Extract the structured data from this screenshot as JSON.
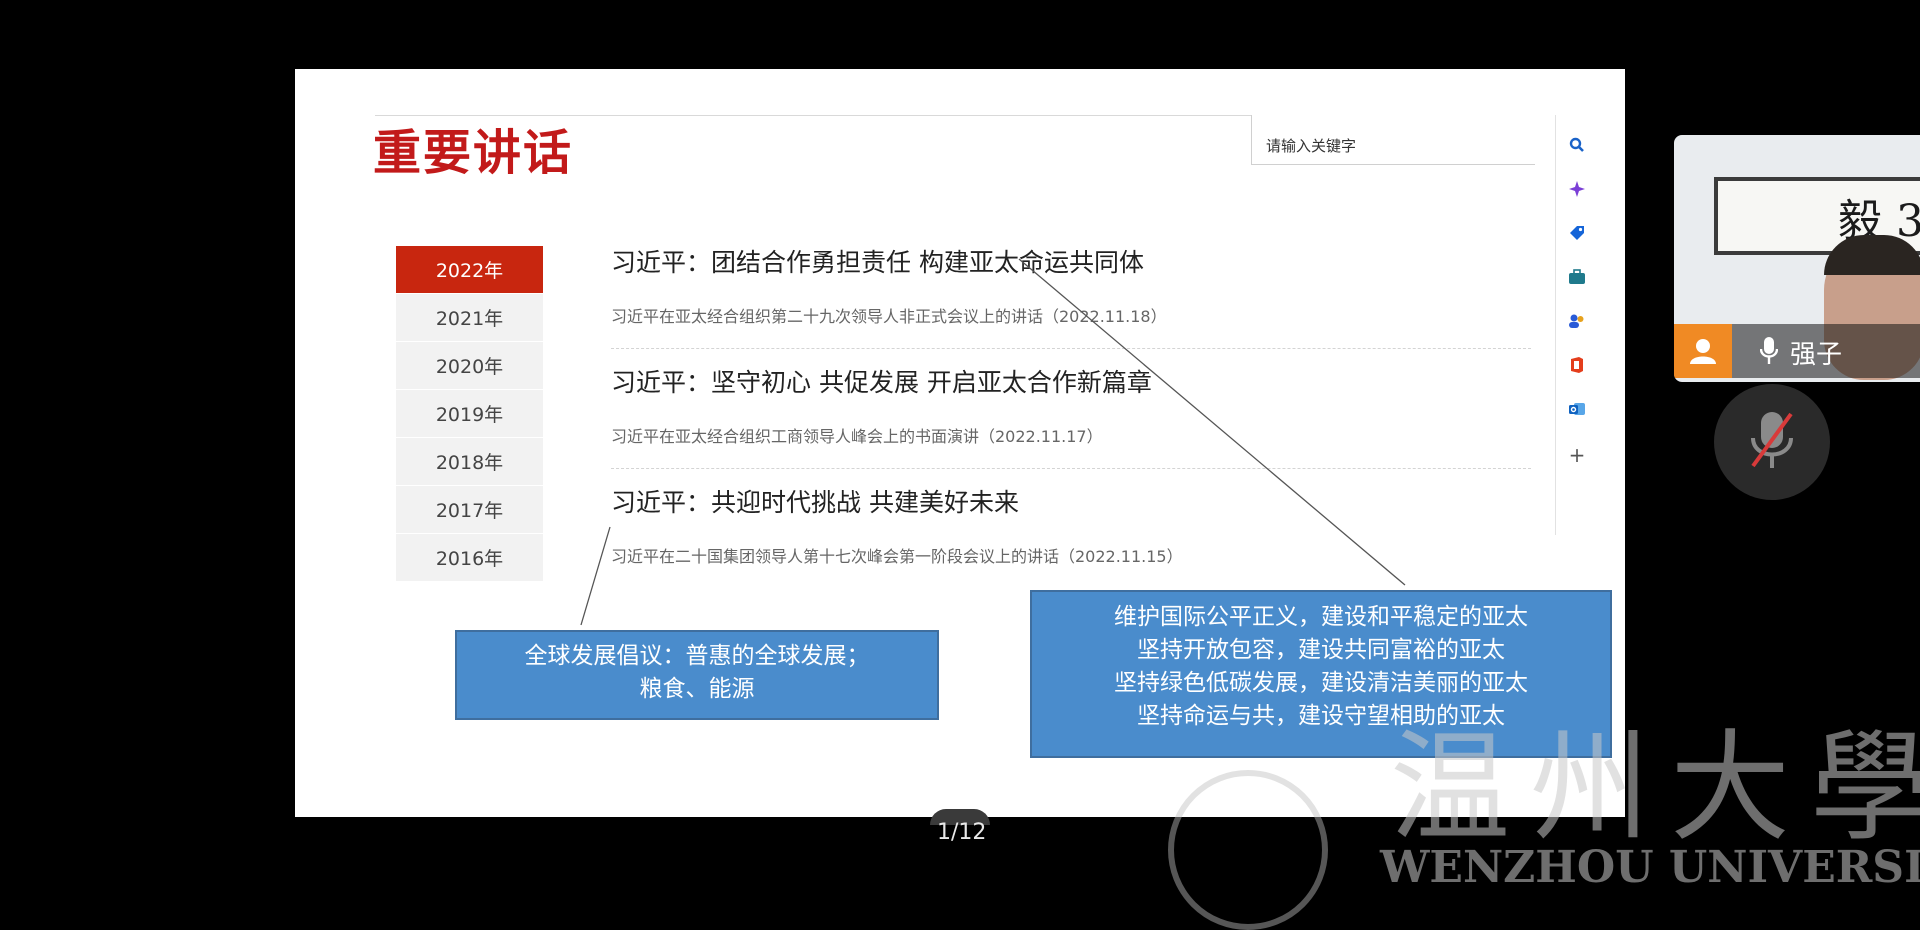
{
  "page": {
    "title": "重要讲话",
    "search_placeholder": "请输入关键字"
  },
  "years": [
    "2022年",
    "2021年",
    "2020年",
    "2019年",
    "2018年",
    "2017年",
    "2016年"
  ],
  "selected_year": "2022年",
  "articles": [
    {
      "title": "习近平：团结合作勇担责任 构建亚太命运共同体",
      "subtitle": "习近平在亚太经合组织第二十九次领导人非正式会议上的讲话（2022.11.18）"
    },
    {
      "title": "习近平：坚守初心 共促发展 开启亚太合作新篇章",
      "subtitle": "习近平在亚太经合组织工商领导人峰会上的书面演讲（2022.11.17）"
    },
    {
      "title": "习近平：共迎时代挑战 共建美好未来",
      "subtitle": "习近平在二十国集团领导人第十七次峰会第一阶段会议上的讲话（2022.11.15）"
    }
  ],
  "annotations": {
    "left": [
      "全球发展倡议：普惠的全球发展；",
      "粮食、能源"
    ],
    "right": [
      "维护国际公平正义，建设和平稳定的亚太",
      "坚持开放包容，建设共同富裕的亚太",
      "坚持绿色低碳发展，建设清洁美丽的亚太",
      "坚持命运与共，建设守望相助的亚太"
    ]
  },
  "pagination": "1/12",
  "participant": {
    "name": "强子"
  },
  "watermark": {
    "chinese": "温州大學",
    "english": "WENZHOU UNIVERSITY"
  },
  "rail_icons": [
    "search-icon",
    "sparkle-icon",
    "tag-icon",
    "briefcase-icon",
    "people-icon",
    "office-icon",
    "outlook-icon",
    "plus-icon"
  ]
}
